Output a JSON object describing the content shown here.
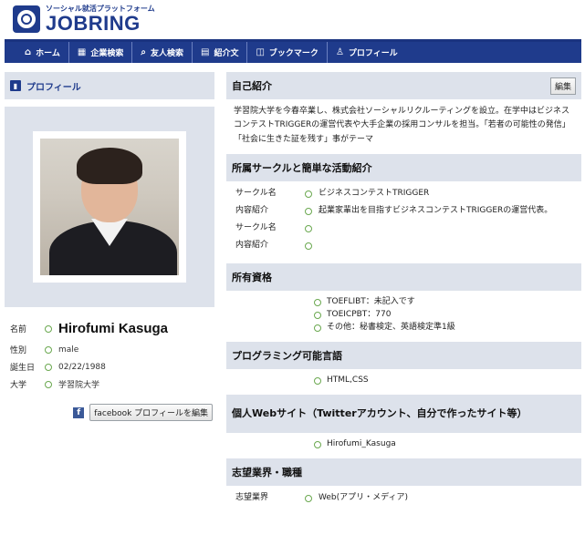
{
  "brand": {
    "tagline": "ソーシャル就活プラットフォーム",
    "name": "JOBRING"
  },
  "nav": [
    {
      "icon": "home-icon",
      "glyph": "⌂",
      "label": "ホーム"
    },
    {
      "icon": "building-icon",
      "glyph": "▦",
      "label": "企業検索"
    },
    {
      "icon": "search-icon",
      "glyph": "⌕",
      "label": "友人検索"
    },
    {
      "icon": "document-icon",
      "glyph": "▤",
      "label": "紹介文"
    },
    {
      "icon": "bookmark-icon",
      "glyph": "◫",
      "label": "ブックマーク"
    },
    {
      "icon": "person-icon",
      "glyph": "♙",
      "label": "プロフィール"
    }
  ],
  "profile_panel": {
    "title": "プロフィール",
    "fields": [
      {
        "label": "名前",
        "value": "Hirofumi Kasuga"
      },
      {
        "label": "性別",
        "value": "male"
      },
      {
        "label": "誕生日",
        "value": "02/22/1988"
      },
      {
        "label": "大学",
        "value": "学習院大学"
      }
    ],
    "facebook_button": "facebook プロフィールを編集"
  },
  "sections": {
    "intro": {
      "title": "自己紹介",
      "edit": "編集",
      "text": "学習院大学を今春卒業し、株式会社ソーシャルリクルーティングを設立。在学中はビジネスコンテストTRIGGERの運営代表や大手企業の採用コンサルを担当。「若者の可能性の発信」「社会に生きた証を残す」事がテーマ"
    },
    "circles": {
      "title": "所属サークルと簡単な活動紹介",
      "rows": [
        {
          "label": "サークル名",
          "value": "ビジネスコンテストTRIGGER"
        },
        {
          "label": "内容紹介",
          "value": "起業家輩出を目指すビジネスコンテストTRIGGERの運営代表。"
        },
        {
          "label": "サークル名",
          "value": ""
        },
        {
          "label": "内容紹介",
          "value": ""
        }
      ]
    },
    "quals": {
      "title": "所有資格",
      "items": [
        "TOEFLIBT：未記入です",
        "TOEICPBT：770",
        "その他：秘書検定、英語検定準1級"
      ]
    },
    "langs": {
      "title": "プログラミング可能言語",
      "items": [
        "HTML,CSS"
      ]
    },
    "web": {
      "title": "個人Webサイト（Twitterアカウント、自分で作ったサイト等）",
      "items": [
        "Hirofumi_Kasuga"
      ]
    },
    "industry": {
      "title": "志望業界・職種",
      "rows": [
        {
          "label": "志望業界",
          "value": "Web(アプリ・メディア)"
        }
      ]
    }
  }
}
